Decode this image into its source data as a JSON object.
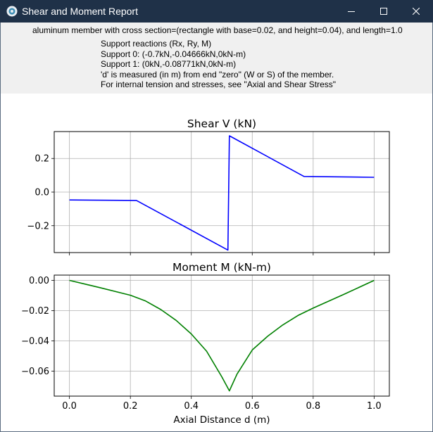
{
  "window": {
    "title": "Shear and Moment Report",
    "app_icon": "gear-icon"
  },
  "controls": {
    "minimize": "minimize-icon",
    "maximize": "maximize-icon",
    "close": "close-icon"
  },
  "header": {
    "description": "aluminum member with cross section=(rectangle with base=0.02, and height=0.04), and length=1.0",
    "reactions_title": "Support reactions (Rx, Ry, M)",
    "support_0": "Support 0: (-0.7kN,-0.04666kN,0kN-m)",
    "support_1": "Support 1: (0kN,-0.08771kN,0kN-m)",
    "note_d": "'d' is measured (in m) from end \"zero\" (W or S) of the member.",
    "note_stress": "For internal tension and stresses, see \"Axial and Shear Stress\""
  },
  "colors": {
    "shear": "#0000ff",
    "moment": "#008000",
    "titlebar": "#1f3148",
    "grid": "#b0b0b0"
  },
  "chart_data": [
    {
      "type": "line",
      "title": "Shear V (kN)",
      "xlabel": "",
      "ylabel": "",
      "xlim": [
        -0.05,
        1.05
      ],
      "ylim": [
        -0.36,
        0.36
      ],
      "xticks": [
        0.0,
        0.2,
        0.4,
        0.6,
        0.8,
        1.0
      ],
      "yticks": [
        {
          "value": 0.2,
          "label": "0.2"
        },
        {
          "value": 0.0,
          "label": "0.0"
        },
        {
          "value": -0.2,
          "label": "−0.2"
        }
      ],
      "grid": true,
      "series": [
        {
          "color": "#0000ff",
          "x": [
            0.0,
            0.22,
            0.52,
            0.525,
            0.77,
            1.0
          ],
          "y": [
            -0.047,
            -0.05,
            -0.345,
            0.335,
            0.093,
            0.088
          ]
        }
      ]
    },
    {
      "type": "line",
      "title": "Moment M (kN-m)",
      "xlabel": "Axial Distance d (m)",
      "ylabel": "",
      "xlim": [
        -0.05,
        1.05
      ],
      "ylim": [
        -0.0765,
        0.0035
      ],
      "xticks": [
        {
          "value": 0.0,
          "label": "0.0"
        },
        {
          "value": 0.2,
          "label": "0.2"
        },
        {
          "value": 0.4,
          "label": "0.4"
        },
        {
          "value": 0.6,
          "label": "0.6"
        },
        {
          "value": 0.8,
          "label": "0.8"
        },
        {
          "value": 1.0,
          "label": "1.0"
        }
      ],
      "yticks": [
        {
          "value": 0.0,
          "label": "0.00"
        },
        {
          "value": -0.02,
          "label": "−0.02"
        },
        {
          "value": -0.04,
          "label": "−0.04"
        },
        {
          "value": -0.06,
          "label": "−0.06"
        }
      ],
      "grid": true,
      "series": [
        {
          "color": "#008000",
          "x": [
            0.0,
            0.1,
            0.2,
            0.25,
            0.3,
            0.35,
            0.4,
            0.45,
            0.5,
            0.525,
            0.55,
            0.6,
            0.65,
            0.7,
            0.75,
            0.8,
            0.9,
            1.0
          ],
          "y": [
            0.0,
            -0.0048,
            -0.0098,
            -0.0136,
            -0.0193,
            -0.0264,
            -0.0354,
            -0.0468,
            -0.0637,
            -0.073,
            -0.062,
            -0.046,
            -0.037,
            -0.0295,
            -0.0232,
            -0.0183,
            -0.0093,
            0.0
          ]
        }
      ]
    }
  ]
}
